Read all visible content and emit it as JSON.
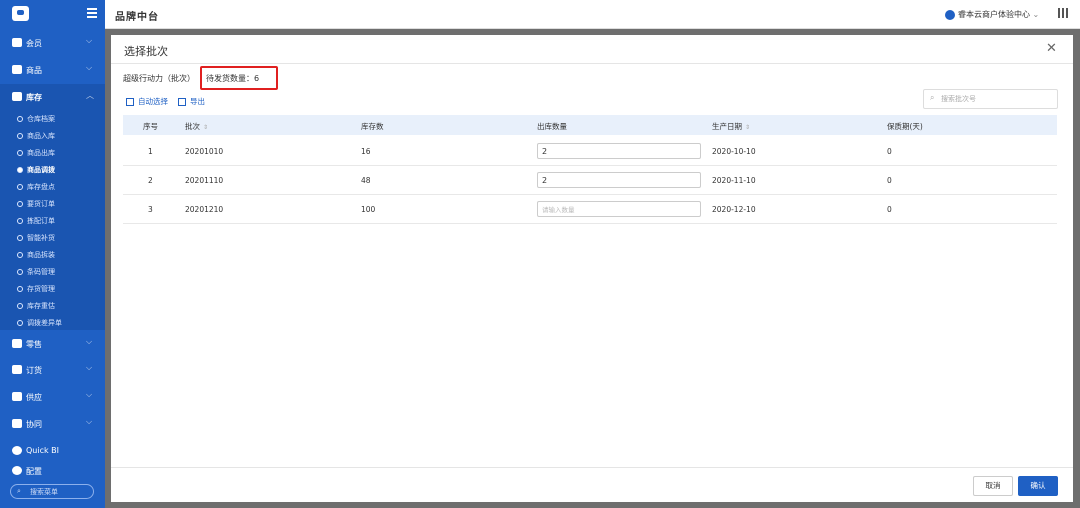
{
  "app": {
    "brand": "品牌中台",
    "user_org": "睿本云商户体验中心"
  },
  "sidebar": {
    "nav": [
      {
        "label": "会员"
      },
      {
        "label": "商品"
      },
      {
        "label": "库存"
      },
      {
        "label": "零售"
      },
      {
        "label": "订货"
      },
      {
        "label": "供应"
      },
      {
        "label": "协同"
      },
      {
        "label": "Quick BI"
      },
      {
        "label": "配置"
      }
    ],
    "sub_items": [
      "仓库档案",
      "商品入库",
      "商品出库",
      "商品调拨",
      "库存盘点",
      "要货订单",
      "拣配订单",
      "智能补货",
      "商品拆装",
      "条码管理",
      "存货管理",
      "库存重估",
      "调拨差异单"
    ],
    "search_placeholder": "搜索菜单"
  },
  "modal": {
    "title": "选择批次",
    "product_name": "超级行动力（批次）",
    "pending_label": "待发货数量：6",
    "auto_select": "自动选择",
    "export": "导出",
    "search_placeholder": "搜索批次号",
    "columns": [
      "序号",
      "批次",
      "库存数",
      "出库数量",
      "生产日期",
      "保质期(天)"
    ],
    "rows": [
      {
        "no": "1",
        "batch": "20201010",
        "stock": "16",
        "qty": "2",
        "date": "2020-10-10",
        "shelf": "0"
      },
      {
        "no": "2",
        "batch": "20201110",
        "stock": "48",
        "qty": "2",
        "date": "2020-11-10",
        "shelf": "0"
      },
      {
        "no": "3",
        "batch": "20201210",
        "stock": "100",
        "qty": "",
        "date": "2020-12-10",
        "shelf": "0"
      }
    ],
    "qty_placeholder": "请输入数量",
    "cancel": "取消",
    "confirm": "确认"
  }
}
